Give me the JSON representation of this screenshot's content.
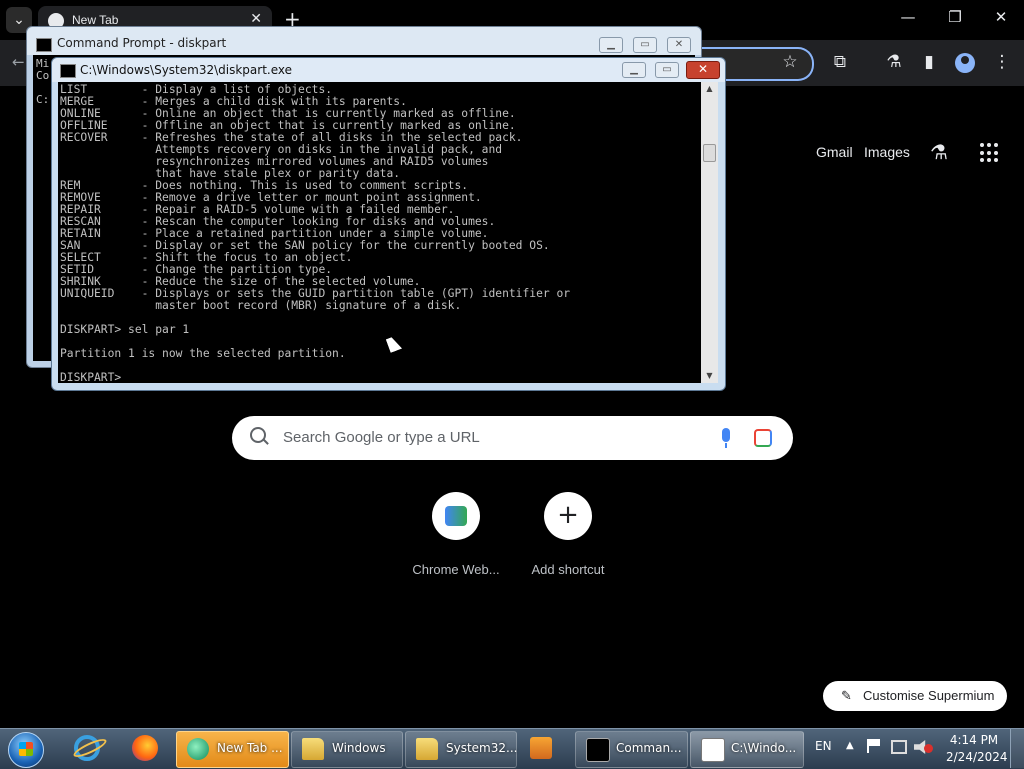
{
  "browser": {
    "tab_title": "New Tab",
    "new_tab_glyph": "+",
    "close_glyph": "✕",
    "window_controls": {
      "minimize": "—",
      "restore": "❐",
      "close": "✕"
    },
    "links": {
      "gmail": "Gmail",
      "images": "Images"
    },
    "search_placeholder": "Search Google or type a URL",
    "shortcuts": [
      {
        "label": "Chrome Web..."
      },
      {
        "label": "Add shortcut"
      }
    ],
    "customise_label": "Customise Supermium",
    "accent_color": "#8ab4f8"
  },
  "cmd_back": {
    "title": "Command Prompt - diskpart",
    "lines": [
      "Mi",
      "Co",
      "C:"
    ]
  },
  "cmd_front": {
    "title": "C:\\Windows\\System32\\diskpart.exe",
    "lines": [
      "LIST        - Display a list of objects.",
      "MERGE       - Merges a child disk with its parents.",
      "ONLINE      - Online an object that is currently marked as offline.",
      "OFFLINE     - Offline an object that is currently marked as online.",
      "RECOVER     - Refreshes the state of all disks in the selected pack.",
      "              Attempts recovery on disks in the invalid pack, and",
      "              resynchronizes mirrored volumes and RAID5 volumes",
      "              that have stale plex or parity data.",
      "REM         - Does nothing. This is used to comment scripts.",
      "REMOVE      - Remove a drive letter or mount point assignment.",
      "REPAIR      - Repair a RAID-5 volume with a failed member.",
      "RESCAN      - Rescan the computer looking for disks and volumes.",
      "RETAIN      - Place a retained partition under a simple volume.",
      "SAN         - Display or set the SAN policy for the currently booted OS.",
      "SELECT      - Shift the focus to an object.",
      "SETID       - Change the partition type.",
      "SHRINK      - Reduce the size of the selected volume.",
      "UNIQUEID    - Displays or sets the GUID partition table (GPT) identifier or",
      "              master boot record (MBR) signature of a disk.",
      "",
      "DISKPART> sel par 1",
      "",
      "Partition 1 is now the selected partition.",
      "",
      "DISKPART>"
    ]
  },
  "taskbar": {
    "tasks": [
      {
        "label": "New Tab ..."
      },
      {
        "label": "Windows"
      },
      {
        "label": "System32..."
      },
      {
        "label": "Comman..."
      },
      {
        "label": "C:\\Windo..."
      }
    ],
    "tray": {
      "lang": "EN",
      "chevron": "▲",
      "time": "4:14 PM",
      "date": "2/24/2024"
    }
  }
}
